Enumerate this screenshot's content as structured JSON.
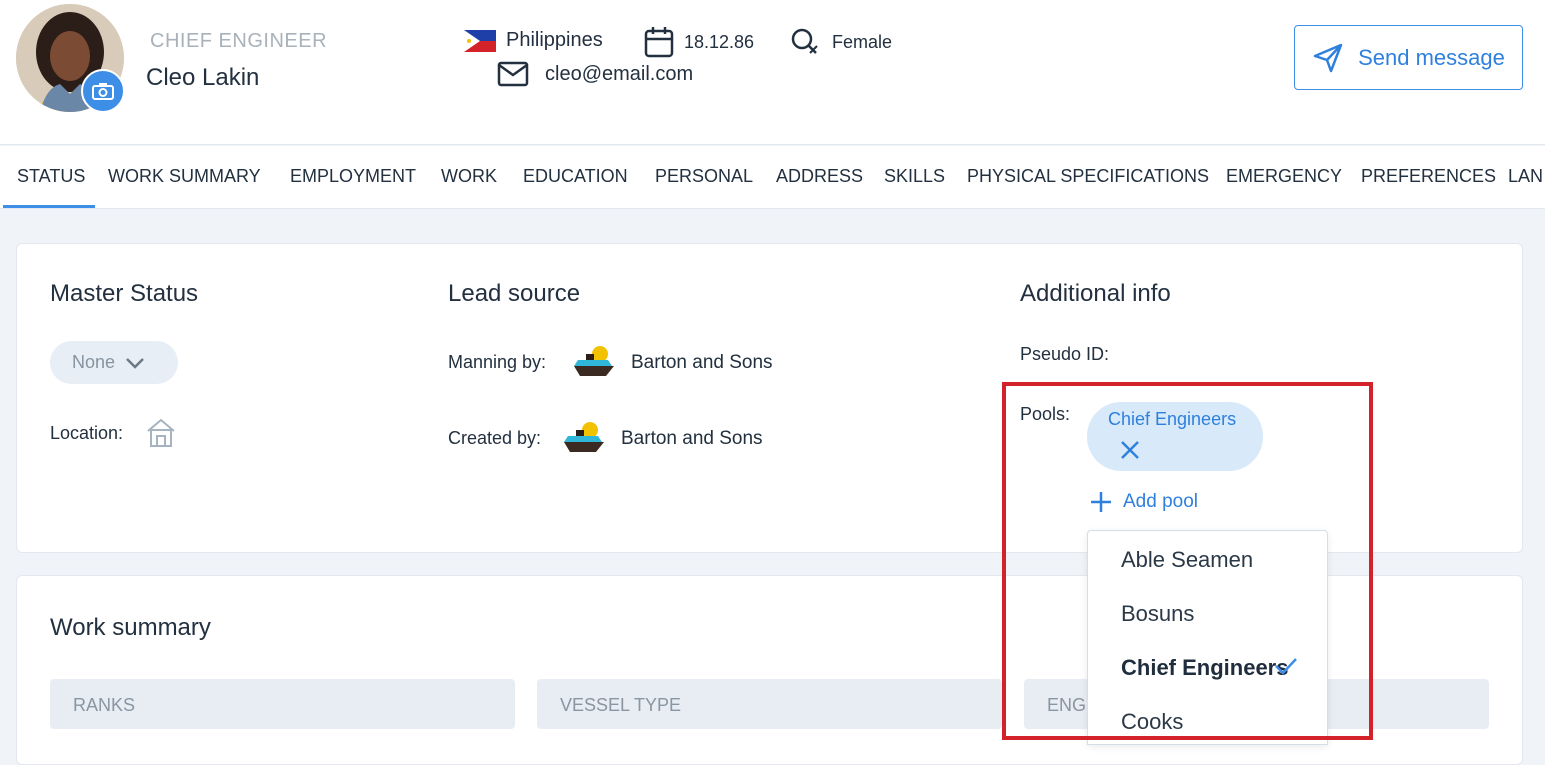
{
  "profile": {
    "rank": "CHIEF ENGINEER",
    "name": "Cleo Lakin",
    "country": "Philippines",
    "birthdate": "18.12.86",
    "gender": "Female",
    "email": "cleo@email.com"
  },
  "actions": {
    "send_message": "Send message"
  },
  "tabs": [
    "STATUS",
    "WORK SUMMARY",
    "EMPLOYMENT",
    "WORK",
    "EDUCATION",
    "PERSONAL",
    "ADDRESS",
    "SKILLS",
    "PHYSICAL SPECIFICATIONS",
    "EMERGENCY",
    "PREFERENCES",
    "LAN"
  ],
  "status": {
    "master_status": {
      "title": "Master Status",
      "value": "None"
    },
    "location_label": "Location:",
    "lead_source": {
      "title": "Lead source",
      "manning_label": "Manning by:",
      "manning_value": "Barton and Sons",
      "created_label": "Created by:",
      "created_value": "Barton and Sons"
    },
    "additional": {
      "title": "Additional info",
      "pseudo_label": "Pseudo ID:",
      "pools_label": "Pools:",
      "selected_pool": "Chief Engineers",
      "add_pool": "Add pool"
    },
    "pool_options": [
      "Able Seamen",
      "Bosuns",
      "Chief Engineers",
      "Cooks"
    ]
  },
  "work_summary": {
    "title": "Work summary",
    "columns": [
      "RANKS",
      "VESSEL TYPE",
      "ENGI"
    ]
  },
  "colors": {
    "accent": "#3d8ee6",
    "highlight": "#d3222a"
  }
}
